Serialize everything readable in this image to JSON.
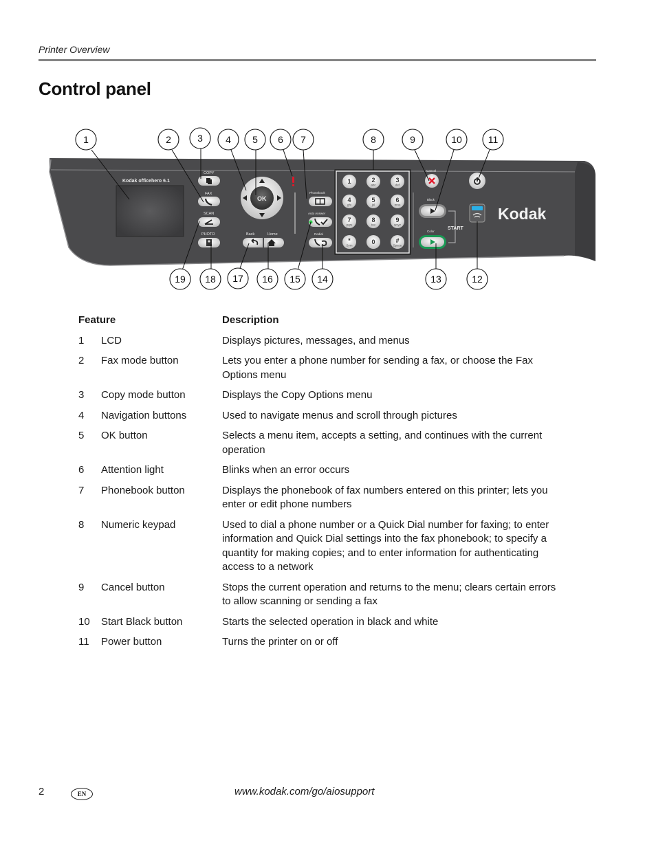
{
  "header": {
    "running_head": "Printer Overview",
    "title": "Control panel"
  },
  "figure": {
    "callouts": [
      "1",
      "2",
      "3",
      "4",
      "5",
      "6",
      "7",
      "8",
      "9",
      "10",
      "11",
      "12",
      "13",
      "14",
      "15",
      "16",
      "17",
      "18",
      "19"
    ],
    "panel_labels": {
      "brand_small": "Kodak officehero 6.1",
      "copy": "COPY",
      "fax": "FAX",
      "scan": "SCAN",
      "photo": "PHOTO",
      "ok": "OK",
      "back": "Back",
      "home": "Home",
      "phonebook": "Phonebook",
      "auto_answer": "Auto Answer",
      "redial": "Redial",
      "cancel": "Cancel",
      "black": "Black",
      "color": "Color",
      "start": "START",
      "brand_large": "Kodak"
    },
    "keypad": [
      {
        "num": "1",
        "sub": ""
      },
      {
        "num": "2",
        "sub": "abc"
      },
      {
        "num": "3",
        "sub": "def"
      },
      {
        "num": "4",
        "sub": "ghi"
      },
      {
        "num": "5",
        "sub": "jkl"
      },
      {
        "num": "6",
        "sub": "mno"
      },
      {
        "num": "7",
        "sub": "pqrs"
      },
      {
        "num": "8",
        "sub": "tuv"
      },
      {
        "num": "9",
        "sub": "wxyz"
      },
      {
        "num": "*",
        "sub": "Sym"
      },
      {
        "num": "0",
        "sub": ""
      },
      {
        "num": "#",
        "sub": "Space"
      }
    ],
    "colors": {
      "panel": "#4a4a4c",
      "attention": "#e0182a",
      "color_start": "#1a9a55",
      "wifi": "#2ab0e8"
    }
  },
  "table": {
    "headers": {
      "feature": "Feature",
      "description": "Description"
    },
    "rows": [
      {
        "num": "1",
        "feature": "LCD",
        "description": "Displays pictures, messages, and menus"
      },
      {
        "num": "2",
        "feature": "Fax mode button",
        "description": "Lets you enter a phone number for sending a fax, or choose the Fax Options menu"
      },
      {
        "num": "3",
        "feature": "Copy mode button",
        "description": "Displays the Copy Options menu"
      },
      {
        "num": "4",
        "feature": "Navigation buttons",
        "description": "Used to navigate menus and scroll through pictures"
      },
      {
        "num": "5",
        "feature": "OK button",
        "description": "Selects a menu item, accepts a setting, and continues with the current operation"
      },
      {
        "num": "6",
        "feature": "Attention light",
        "description": "Blinks when an error occurs"
      },
      {
        "num": "7",
        "feature": "Phonebook button",
        "description": "Displays the phonebook of fax numbers entered on this printer; lets you enter or edit phone numbers"
      },
      {
        "num": "8",
        "feature": "Numeric keypad",
        "description": "Used to dial a phone number or a Quick Dial number for faxing; to enter information and Quick Dial settings into the fax phonebook; to specify a quantity for making copies; and to enter information for authenticating access to a network"
      },
      {
        "num": "9",
        "feature": "Cancel button",
        "description": "Stops the current operation and returns to the menu; clears certain errors to allow scanning or sending a fax"
      },
      {
        "num": "10",
        "feature": "Start Black button",
        "description": "Starts the selected operation in black and white"
      },
      {
        "num": "11",
        "feature": "Power button",
        "description": "Turns the printer on or off"
      }
    ]
  },
  "footer": {
    "page_number": "2",
    "language_badge": "EN",
    "url": "www.kodak.com/go/aiosupport"
  }
}
